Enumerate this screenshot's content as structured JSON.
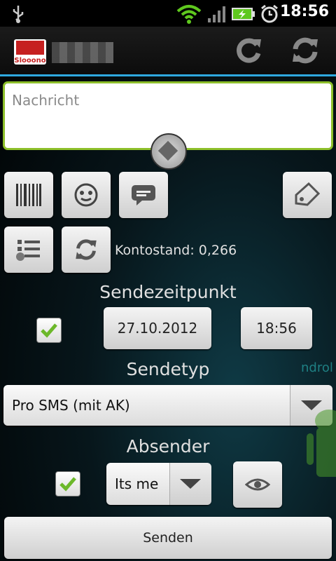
{
  "status_bar": {
    "time": "18:56"
  },
  "action_bar": {
    "logo_text": "Slooono"
  },
  "message": {
    "placeholder": "Nachricht"
  },
  "account": {
    "balance_label": "Kontostand: 0,266"
  },
  "schedule": {
    "title": "Sendezeitpunkt",
    "date": "27.10.2012",
    "time": "18:56",
    "enabled": true
  },
  "send_type": {
    "title": "Sendetyp",
    "selected": "Pro SMS (mit AK)"
  },
  "sender": {
    "title": "Absender",
    "selected": "Its me",
    "enabled": true
  },
  "send_button": {
    "label": "Senden"
  },
  "colors": {
    "accent": "#2ea9e0",
    "field_border": "#8dbf2a",
    "check": "#6cb82a"
  }
}
